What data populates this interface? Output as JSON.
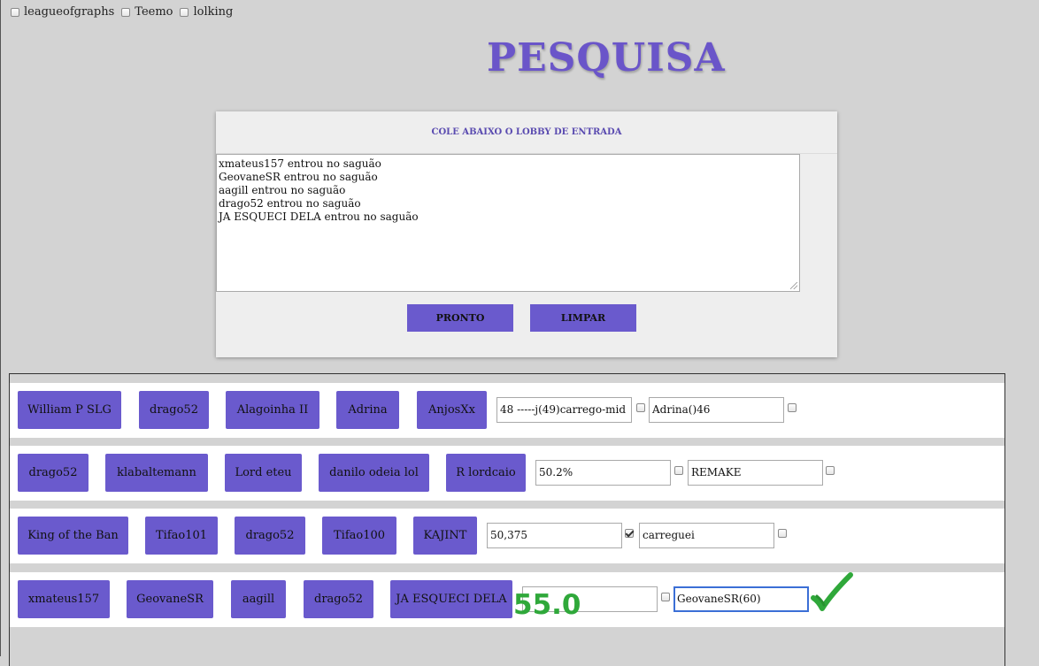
{
  "sites": [
    {
      "label": "leagueofgraphs",
      "checked": false
    },
    {
      "label": "Teemo",
      "checked": false
    },
    {
      "label": "lolking",
      "checked": false
    }
  ],
  "title": "PESQUISA",
  "lobby": {
    "heading": "COLE ABAIXO O LOBBY DE ENTRADA",
    "lines": [
      "xmateus157 entrou no saguão",
      "GeovaneSR entrou no saguão",
      "aagill entrou no saguão",
      "drago52 entrou no saguão",
      "JA ESQUECI DELA entrou no saguão"
    ],
    "ready_label": "PRONTO",
    "clear_label": "LIMPAR"
  },
  "rows": [
    {
      "players": [
        "William P SLG",
        "drago52",
        "Alagoinha II",
        "Adrina",
        "AnjosXx"
      ],
      "field1": "48 -----j(49)carrego-mid",
      "check1": false,
      "field2": "Adrina()46",
      "check2": false
    },
    {
      "players": [
        "drago52",
        "klabaltemann",
        "Lord eteu",
        "danilo odeia lol",
        "R lordcaio"
      ],
      "field1": "50.2%",
      "check1": false,
      "field2": "REMAKE",
      "check2": false
    },
    {
      "players": [
        "King of the Ban",
        "Tifao101",
        "drago52",
        "Tifao100",
        "KAJINT"
      ],
      "field1": "50,375",
      "check1": true,
      "field2": "carreguei",
      "check2": false
    },
    {
      "players": [
        "xmateus157",
        "GeovaneSR",
        "aagill",
        "drago52",
        "JA ESQUECI DELA"
      ],
      "field1": "",
      "check1": false,
      "field2": "GeovaneSR(60)",
      "check2": null
    }
  ],
  "score_overlay": "55.0",
  "colors": {
    "accent": "#6a5acd",
    "title": "#6a55c9",
    "score": "#2fa83a",
    "background": "#d3d3d3"
  }
}
